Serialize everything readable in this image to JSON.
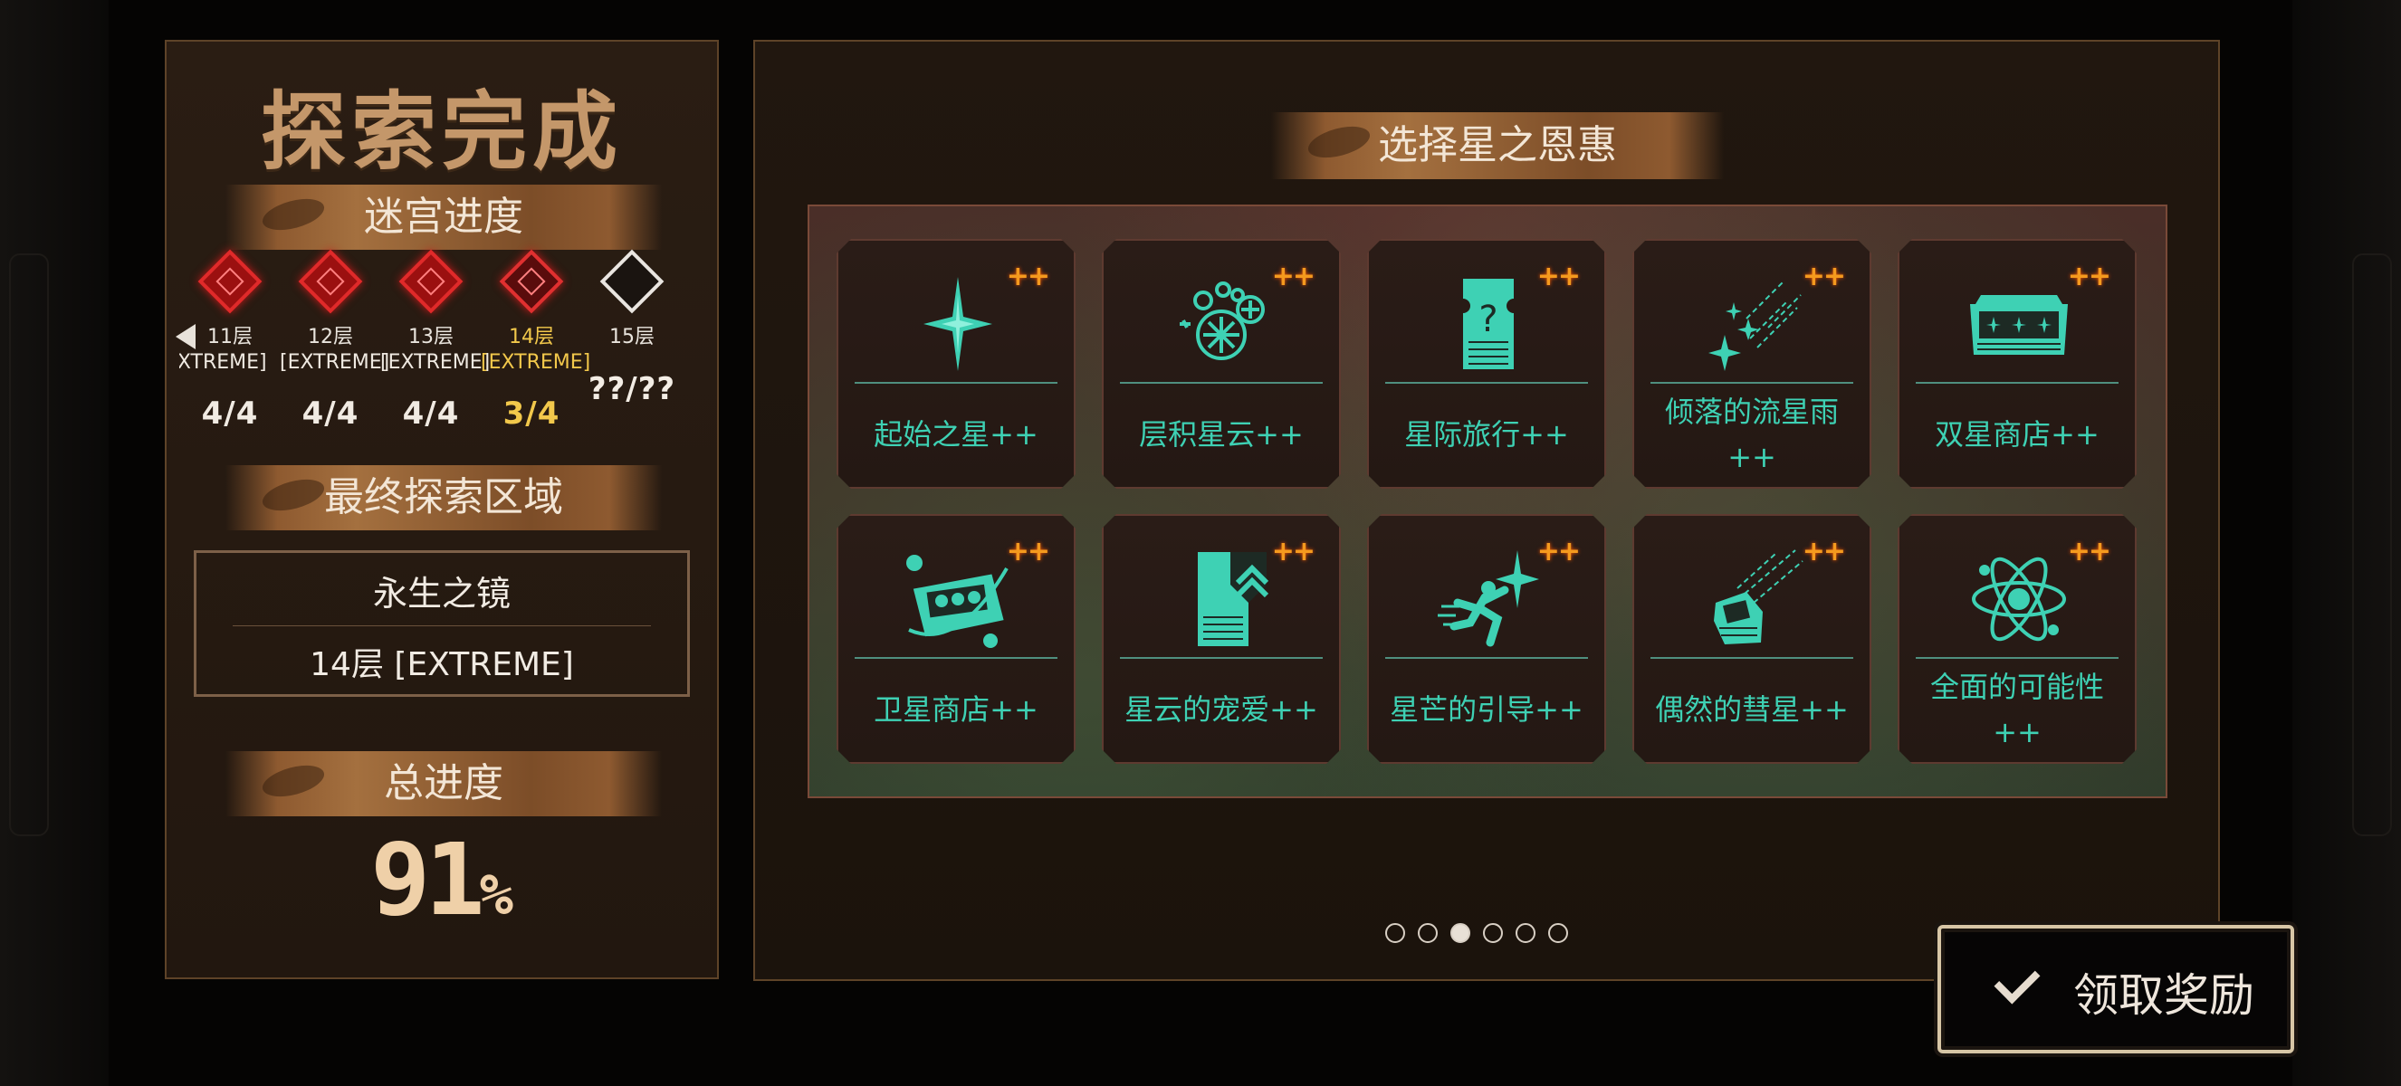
{
  "title": "探索完成",
  "maze": {
    "banner": "迷宫进度",
    "floors": [
      {
        "name": "11层",
        "difficulty": "[EXTREME]",
        "score": "4/4",
        "state": "done"
      },
      {
        "name": "12层",
        "difficulty": "[EXTREME]",
        "score": "4/4",
        "state": "done"
      },
      {
        "name": "13层",
        "difficulty": "[EXTREME]",
        "score": "4/4",
        "state": "done"
      },
      {
        "name": "14层",
        "difficulty": "[EXTREME]",
        "score": "3/4",
        "state": "current"
      },
      {
        "name": "15层",
        "difficulty": "",
        "score": "??/??",
        "state": "locked"
      }
    ]
  },
  "final_area": {
    "banner": "最终探索区域",
    "name": "永生之镜",
    "floor": "14层 [EXTREME]"
  },
  "total_progress": {
    "banner": "总进度",
    "value": "91",
    "unit": "%"
  },
  "boons": {
    "banner": "选择星之恩惠",
    "accent_color": "#3ed1b4",
    "plus_color": "#f59a1e",
    "plus_label": "++",
    "cards": [
      {
        "name": "起始之星++",
        "icon": "sparkle-star-icon"
      },
      {
        "name": "层积星云++",
        "icon": "nebula-cluster-icon"
      },
      {
        "name": "星际旅行++",
        "icon": "mystery-ticket-icon"
      },
      {
        "name": "倾落的流星雨++",
        "icon": "meteor-shower-icon"
      },
      {
        "name": "双星商店++",
        "icon": "double-star-shop-icon"
      },
      {
        "name": "卫星商店++",
        "icon": "satellite-shop-icon"
      },
      {
        "name": "星云的宠爱++",
        "icon": "upgrade-ticket-icon"
      },
      {
        "name": "星芒的引导++",
        "icon": "running-star-icon"
      },
      {
        "name": "偶然的彗星++",
        "icon": "falling-comet-icon"
      },
      {
        "name": "全面的可能性++",
        "icon": "atom-icon"
      }
    ],
    "pages": 6,
    "active_page": 3
  },
  "claim_button": {
    "label": "领取奖励",
    "icon": "checkmark-icon"
  }
}
